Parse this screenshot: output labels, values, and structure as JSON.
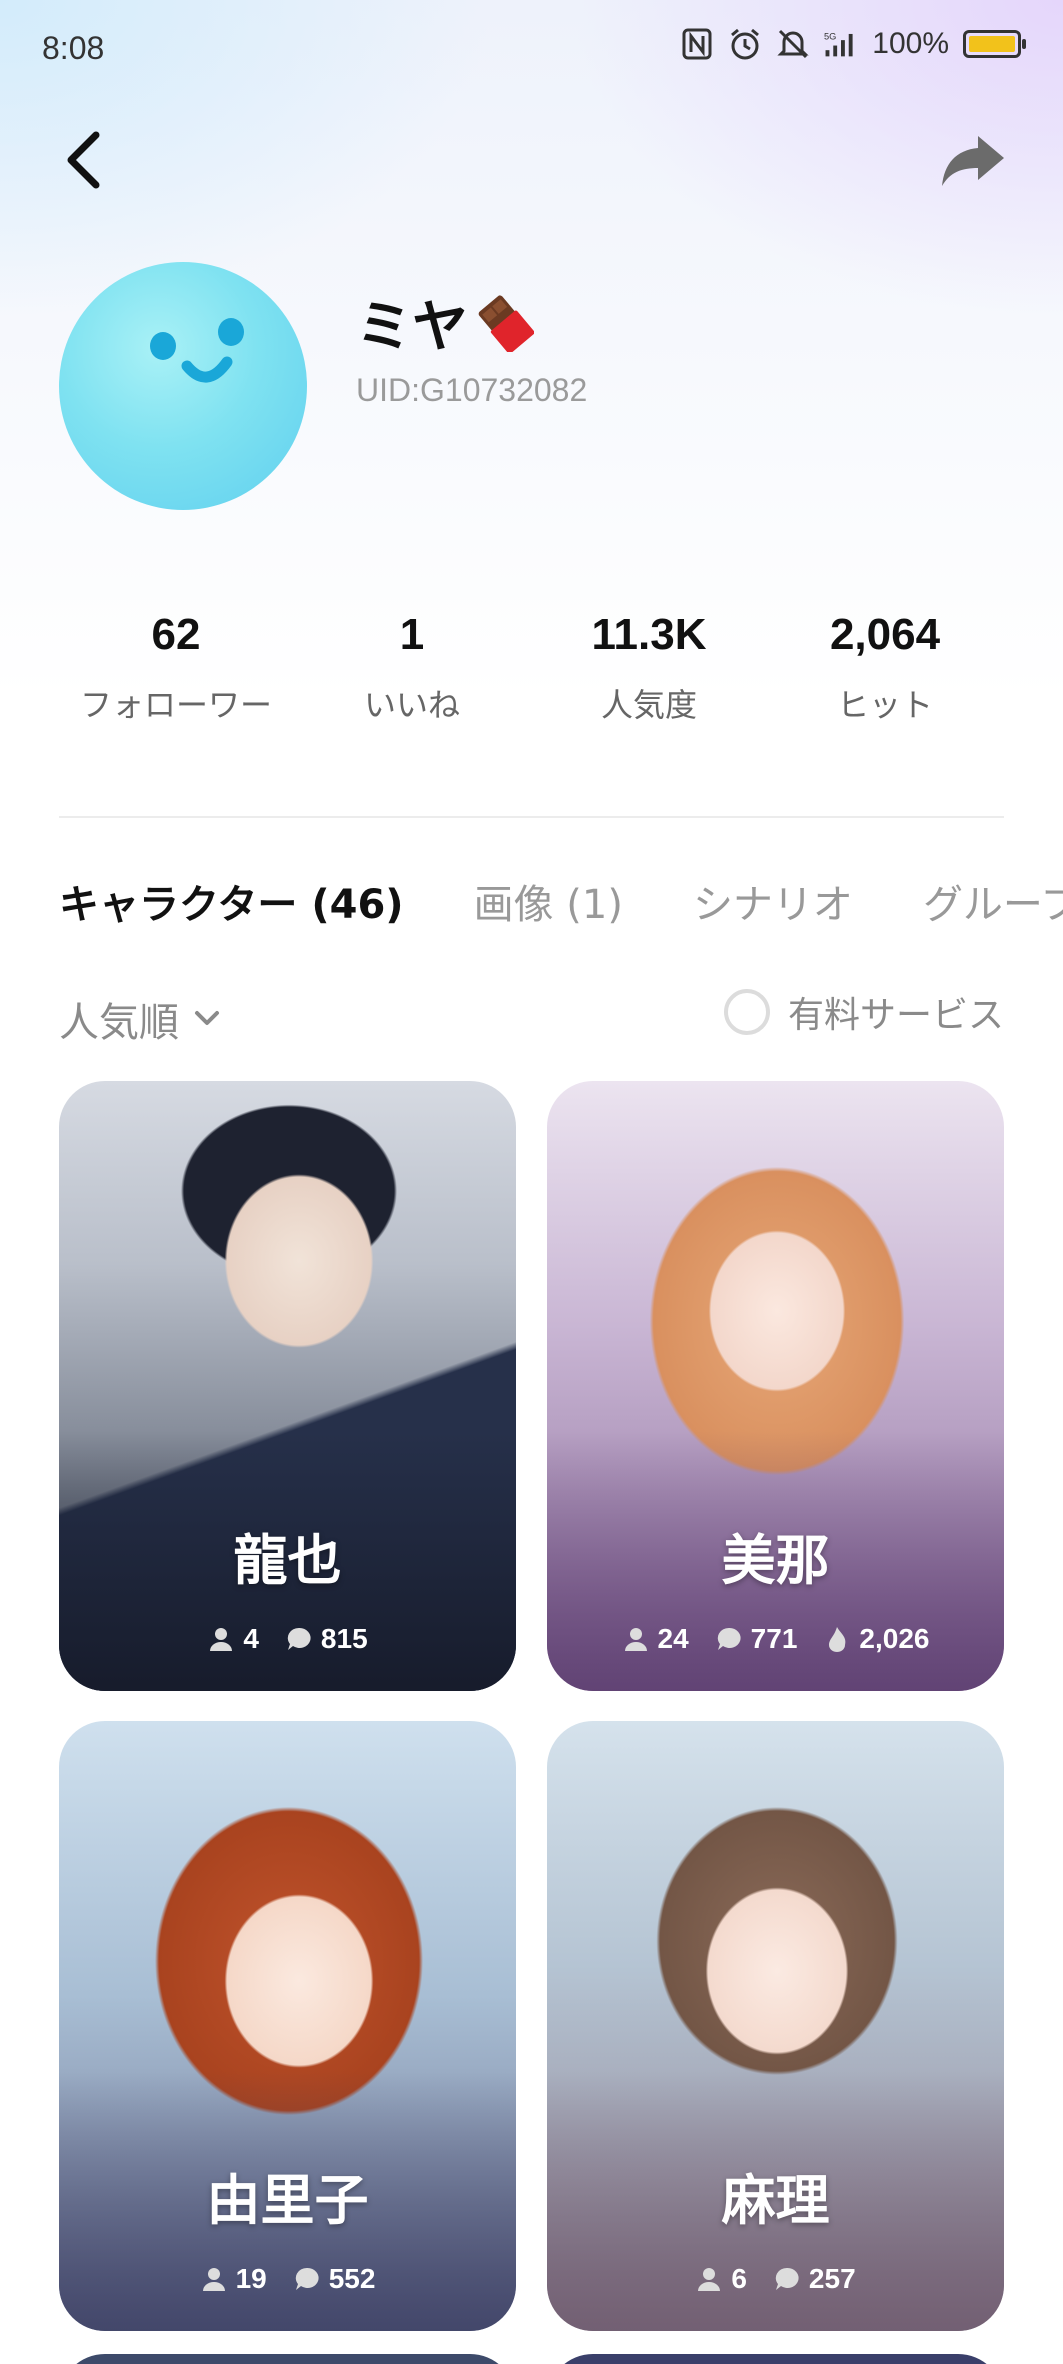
{
  "status_bar": {
    "time": "8:08",
    "network": "5G",
    "battery": "100%"
  },
  "header": {
    "back_icon": "back-arrow-icon",
    "share_icon": "share-icon"
  },
  "profile": {
    "name": "ミヤ",
    "name_emoji": "chocolate-bar-icon",
    "uid": "UID:G10732082"
  },
  "stats": [
    {
      "value": "62",
      "label": "フォローワー"
    },
    {
      "value": "1",
      "label": "いいね"
    },
    {
      "value": "11.3K",
      "label": "人気度"
    },
    {
      "value": "2,064",
      "label": "ヒット"
    }
  ],
  "tabs": [
    {
      "label": "キャラクター (46)",
      "active": true
    },
    {
      "label": "画像 (1)",
      "active": false
    },
    {
      "label": "シナリオ",
      "active": false
    },
    {
      "label": "グループ",
      "active": false
    }
  ],
  "sort": {
    "label": "人気順"
  },
  "filter": {
    "label": "有料サービス",
    "checked": false
  },
  "cards": [
    {
      "name": "龍也",
      "users": "4",
      "chats": "815",
      "likes": ""
    },
    {
      "name": "美那",
      "users": "24",
      "chats": "771",
      "likes": "2,026"
    },
    {
      "name": "由里子",
      "users": "19",
      "chats": "552",
      "likes": ""
    },
    {
      "name": "麻理",
      "users": "6",
      "chats": "257",
      "likes": ""
    }
  ],
  "colors": {
    "avatar": "#7fe2f1",
    "avatar_face": "#1aa7d8",
    "card1": "#3a4253",
    "card2": "#8a6b99",
    "card3": "#6b6f8e",
    "card4": "#8c7f8f"
  }
}
